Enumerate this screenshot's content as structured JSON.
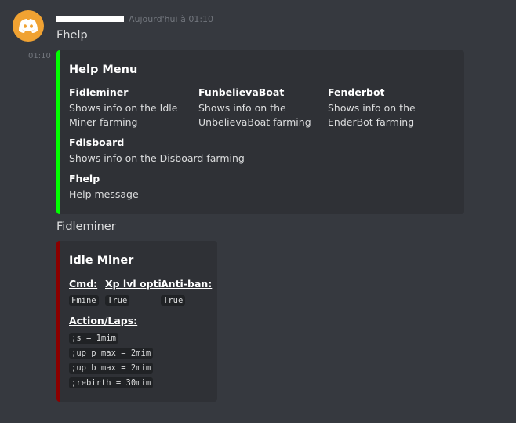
{
  "message": {
    "timestamp": "Aujourd'hui à 01:10",
    "side_time": "01:10",
    "first_text": "Fhelp",
    "second_text": "Fidleminer"
  },
  "help_embed": {
    "title": "Help Menu",
    "color": "#00ff00",
    "fields": [
      {
        "name": "Fidleminer",
        "value_line1": "Shows info on the Idle",
        "value_line2": "Miner farming"
      },
      {
        "name": "FunbelievaBoat",
        "value_line1": "Shows info on the",
        "value_line2": "UnbelievaBoat farming"
      },
      {
        "name": "Fenderbot",
        "value_line1": "Shows info on the",
        "value_line2": "EnderBot farming"
      },
      {
        "name": "Fdisboard",
        "value_line1": "Shows info on the Disboard farming"
      },
      {
        "name": "Fhelp",
        "value_line1": "Help message"
      }
    ]
  },
  "idle_embed": {
    "title": "Idle Miner",
    "color": "#8b0000",
    "cmd_name": "Cmd:",
    "cmd_value": "Fmine",
    "xp_name": "Xp lvl opti:",
    "xp_value": "True",
    "antiban_name": "Anti-ban:",
    "antiban_value": "True",
    "laps_name": "Action/Laps:",
    "laps": [
      ";s = 1mim",
      ";up p max = 2mim",
      ";up b max = 2mim",
      ";rebirth = 30mim"
    ]
  }
}
